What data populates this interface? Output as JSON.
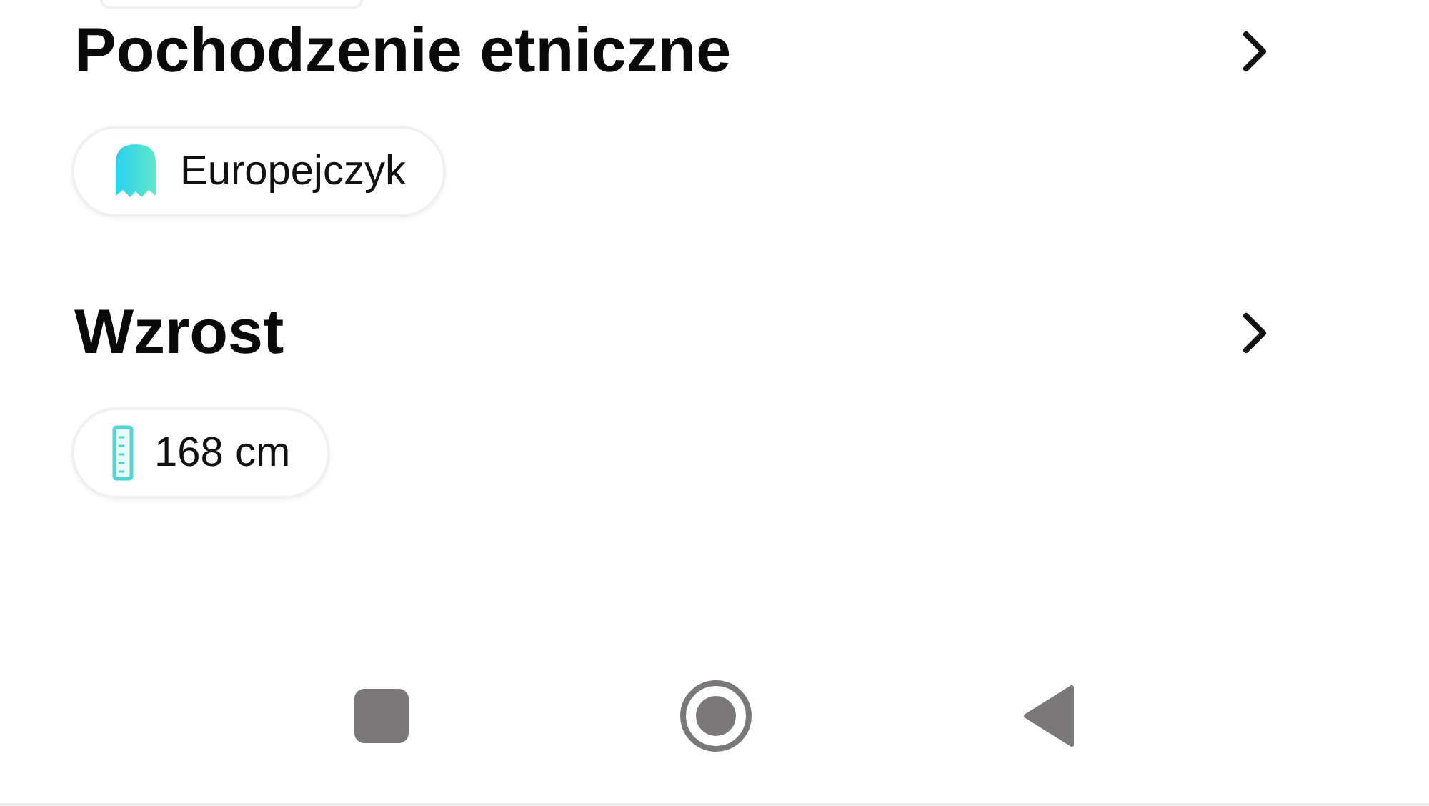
{
  "sections": [
    {
      "title": "Pochodzenie etniczne",
      "chip": {
        "kind": "ethnicity",
        "label": "Europejczyk"
      }
    },
    {
      "title": "Wzrost",
      "chip": {
        "kind": "height",
        "label": "168 cm"
      }
    }
  ]
}
